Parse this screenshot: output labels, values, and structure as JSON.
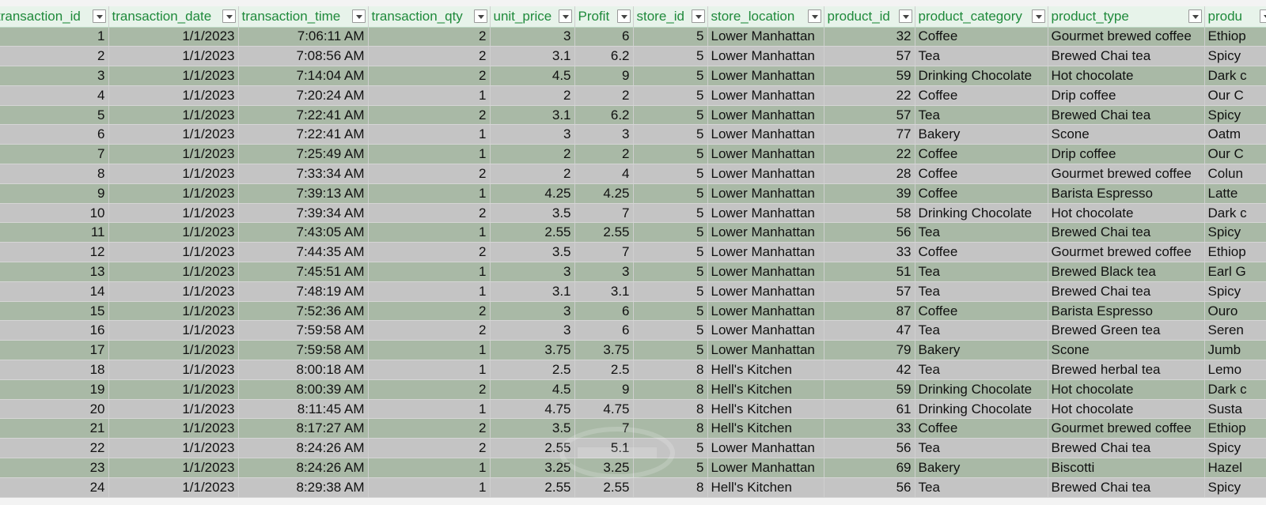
{
  "sheet": {
    "columns": [
      {
        "key": "transaction_id",
        "label": "transaction_id",
        "align": "num"
      },
      {
        "key": "transaction_date",
        "label": "transaction_date",
        "align": "num"
      },
      {
        "key": "transaction_time",
        "label": "transaction_time",
        "align": "num"
      },
      {
        "key": "transaction_qty",
        "label": "transaction_qty",
        "align": "num"
      },
      {
        "key": "unit_price",
        "label": "unit_price",
        "align": "num"
      },
      {
        "key": "profit",
        "label": "Profit",
        "align": "num"
      },
      {
        "key": "store_id",
        "label": "store_id",
        "align": "num"
      },
      {
        "key": "store_location",
        "label": "store_location",
        "align": "txt"
      },
      {
        "key": "product_id",
        "label": "product_id",
        "align": "num"
      },
      {
        "key": "product_category",
        "label": "product_category",
        "align": "txt"
      },
      {
        "key": "product_type",
        "label": "product_type",
        "align": "txt"
      },
      {
        "key": "product_detail",
        "label": "produ",
        "align": "txt"
      }
    ],
    "filter_icon": "dropdown-arrow-icon",
    "row_colors": {
      "odd": "#a9b9a6",
      "even": "#c4c4c4",
      "header_bg": "#e7f3ea",
      "header_text": "#1f8a3b"
    },
    "rows": [
      [
        "1",
        "1/1/2023",
        "7:06:11 AM",
        "2",
        "3",
        "6",
        "5",
        "Lower Manhattan",
        "32",
        "Coffee",
        "Gourmet brewed coffee",
        "Ethiop"
      ],
      [
        "2",
        "1/1/2023",
        "7:08:56 AM",
        "2",
        "3.1",
        "6.2",
        "5",
        "Lower Manhattan",
        "57",
        "Tea",
        "Brewed Chai tea",
        "Spicy"
      ],
      [
        "3",
        "1/1/2023",
        "7:14:04 AM",
        "2",
        "4.5",
        "9",
        "5",
        "Lower Manhattan",
        "59",
        "Drinking Chocolate",
        "Hot chocolate",
        "Dark c"
      ],
      [
        "4",
        "1/1/2023",
        "7:20:24 AM",
        "1",
        "2",
        "2",
        "5",
        "Lower Manhattan",
        "22",
        "Coffee",
        "Drip coffee",
        "Our C"
      ],
      [
        "5",
        "1/1/2023",
        "7:22:41 AM",
        "2",
        "3.1",
        "6.2",
        "5",
        "Lower Manhattan",
        "57",
        "Tea",
        "Brewed Chai tea",
        "Spicy"
      ],
      [
        "6",
        "1/1/2023",
        "7:22:41 AM",
        "1",
        "3",
        "3",
        "5",
        "Lower Manhattan",
        "77",
        "Bakery",
        "Scone",
        "Oatm"
      ],
      [
        "7",
        "1/1/2023",
        "7:25:49 AM",
        "1",
        "2",
        "2",
        "5",
        "Lower Manhattan",
        "22",
        "Coffee",
        "Drip coffee",
        "Our C"
      ],
      [
        "8",
        "1/1/2023",
        "7:33:34 AM",
        "2",
        "2",
        "4",
        "5",
        "Lower Manhattan",
        "28",
        "Coffee",
        "Gourmet brewed coffee",
        "Colun"
      ],
      [
        "9",
        "1/1/2023",
        "7:39:13 AM",
        "1",
        "4.25",
        "4.25",
        "5",
        "Lower Manhattan",
        "39",
        "Coffee",
        "Barista Espresso",
        "Latte"
      ],
      [
        "10",
        "1/1/2023",
        "7:39:34 AM",
        "2",
        "3.5",
        "7",
        "5",
        "Lower Manhattan",
        "58",
        "Drinking Chocolate",
        "Hot chocolate",
        "Dark c"
      ],
      [
        "11",
        "1/1/2023",
        "7:43:05 AM",
        "1",
        "2.55",
        "2.55",
        "5",
        "Lower Manhattan",
        "56",
        "Tea",
        "Brewed Chai tea",
        "Spicy"
      ],
      [
        "12",
        "1/1/2023",
        "7:44:35 AM",
        "2",
        "3.5",
        "7",
        "5",
        "Lower Manhattan",
        "33",
        "Coffee",
        "Gourmet brewed coffee",
        "Ethiop"
      ],
      [
        "13",
        "1/1/2023",
        "7:45:51 AM",
        "1",
        "3",
        "3",
        "5",
        "Lower Manhattan",
        "51",
        "Tea",
        "Brewed Black tea",
        "Earl G"
      ],
      [
        "14",
        "1/1/2023",
        "7:48:19 AM",
        "1",
        "3.1",
        "3.1",
        "5",
        "Lower Manhattan",
        "57",
        "Tea",
        "Brewed Chai tea",
        "Spicy"
      ],
      [
        "15",
        "1/1/2023",
        "7:52:36 AM",
        "2",
        "3",
        "6",
        "5",
        "Lower Manhattan",
        "87",
        "Coffee",
        "Barista Espresso",
        "Ouro"
      ],
      [
        "16",
        "1/1/2023",
        "7:59:58 AM",
        "2",
        "3",
        "6",
        "5",
        "Lower Manhattan",
        "47",
        "Tea",
        "Brewed Green tea",
        "Seren"
      ],
      [
        "17",
        "1/1/2023",
        "7:59:58 AM",
        "1",
        "3.75",
        "3.75",
        "5",
        "Lower Manhattan",
        "79",
        "Bakery",
        "Scone",
        "Jumb"
      ],
      [
        "18",
        "1/1/2023",
        "8:00:18 AM",
        "1",
        "2.5",
        "2.5",
        "8",
        "Hell's Kitchen",
        "42",
        "Tea",
        "Brewed herbal tea",
        "Lemo"
      ],
      [
        "19",
        "1/1/2023",
        "8:00:39 AM",
        "2",
        "4.5",
        "9",
        "8",
        "Hell's Kitchen",
        "59",
        "Drinking Chocolate",
        "Hot chocolate",
        "Dark c"
      ],
      [
        "20",
        "1/1/2023",
        "8:11:45 AM",
        "1",
        "4.75",
        "4.75",
        "8",
        "Hell's Kitchen",
        "61",
        "Drinking Chocolate",
        "Hot chocolate",
        "Susta"
      ],
      [
        "21",
        "1/1/2023",
        "8:17:27 AM",
        "2",
        "3.5",
        "7",
        "8",
        "Hell's Kitchen",
        "33",
        "Coffee",
        "Gourmet brewed coffee",
        "Ethiop"
      ],
      [
        "22",
        "1/1/2023",
        "8:24:26 AM",
        "2",
        "2.55",
        "5.1",
        "5",
        "Lower Manhattan",
        "56",
        "Tea",
        "Brewed Chai tea",
        "Spicy"
      ],
      [
        "23",
        "1/1/2023",
        "8:24:26 AM",
        "1",
        "3.25",
        "3.25",
        "5",
        "Lower Manhattan",
        "69",
        "Bakery",
        "Biscotti",
        "Hazel"
      ],
      [
        "24",
        "1/1/2023",
        "8:29:38 AM",
        "1",
        "2.55",
        "2.55",
        "8",
        "Hell's Kitchen",
        "56",
        "Tea",
        "Brewed Chai tea",
        "Spicy"
      ]
    ]
  }
}
